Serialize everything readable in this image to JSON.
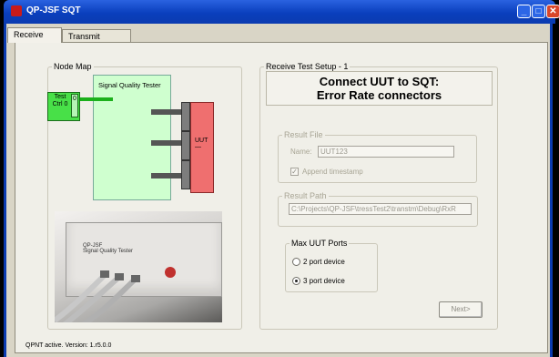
{
  "window": {
    "title": "QP-JSF SQT",
    "min_glyph": "_",
    "max_glyph": "□",
    "close_glyph": "✕"
  },
  "tabs": [
    {
      "label": "Receive",
      "selected": true
    },
    {
      "label": "Transmit",
      "selected": false
    }
  ],
  "node_map": {
    "legend": "Node Map",
    "tester_label": "Signal Quality Tester",
    "ctrl_label": "Test Ctrl 0",
    "ctrl_port": "0",
    "uut_label": "UUT",
    "uut_sub": "—",
    "port_count": 3,
    "photo_text": "QP-JSF\nSignal Quality Tester"
  },
  "setup": {
    "legend": "Receive Test Setup - 1",
    "banner_line1": "Connect UUT to SQT:",
    "banner_line2": "Error Rate connectors",
    "result_file": {
      "legend": "Result File",
      "name_label": "Name:",
      "name_value": "UUT123",
      "append_label": "Append timestamp",
      "append_checked": true
    },
    "result_path": {
      "legend": "Result Path",
      "value": "C:\\Projects\\QP-JSF\\tressTest2\\transtm\\Debug\\RxR"
    },
    "max_ports": {
      "legend": "Max UUT Ports",
      "options": [
        {
          "label": "2 port device",
          "selected": false
        },
        {
          "label": "3 port device",
          "selected": true
        }
      ]
    },
    "next_label": "Next>"
  },
  "status": "QPNT active. Version: 1.r5.0.0",
  "colors": {
    "tester_fill": "#cfffcf",
    "ctrl_fill": "#48e048",
    "uut_fill": "#ef6f6f",
    "titlebar": "#0a3fbd"
  }
}
